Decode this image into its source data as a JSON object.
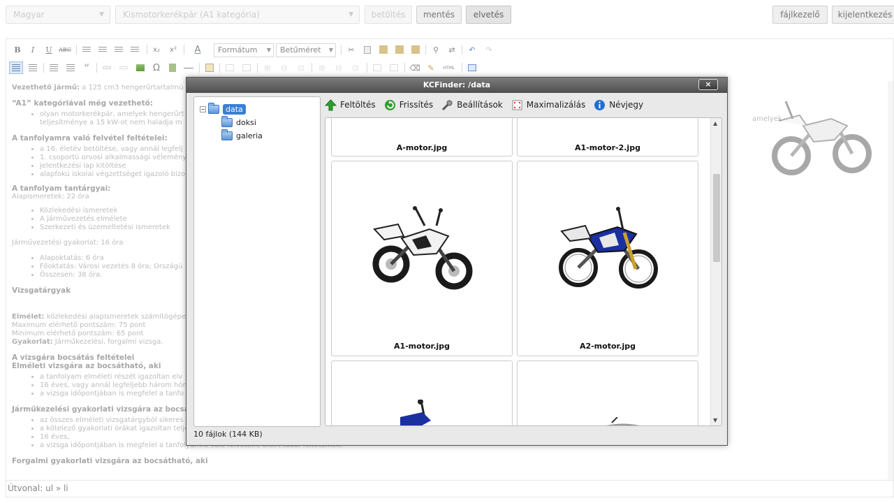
{
  "topbar": {
    "language": "Magyar",
    "category": "Kismotorkerékpár (A1 kategória)",
    "load_label": "betöltés",
    "save_label": "mentés",
    "discard_label": "elvetés",
    "filemanager_label": "fájlkezelő",
    "logout_label": "kijelentkezés"
  },
  "toolbar": {
    "bold": "B",
    "italic": "I",
    "underline": "U",
    "strike": "ABC",
    "subscript": "x₂",
    "superscript": "x²",
    "text_color": "A",
    "format_placeholder": "Formátum",
    "size_placeholder": "Betűméret",
    "omega": "Ω",
    "blockquote": "“",
    "html_label": "HTML"
  },
  "content": {
    "p1_label": "Vezethető jármű:",
    "p1_text": " a 125 cm3 hengerűrtartalmú",
    "h_a1": "“A1” kategóriával még vezethető:",
    "a1_item1": "olyan motorkerékpár, amelyek hengerűrt",
    "a1_item1_tail": "amelyek",
    "a1_item2": "teljesítménye a 15 kW-ot nem haladja m",
    "h_admission": "A tanfolyamra való felvétel feltételei:",
    "adm_items": [
      "a 16. életév betöltése, vagy annál legfelj",
      "1. csoportú orvosi alkalmassági vélemény",
      "jelentkezési lap kitöltése",
      "alapfokú iskolai végzettséget igazoló bizo"
    ],
    "h_subjects": "A tanfolyam tantárgyai:",
    "basics": "Alapismeretek: 22 óra",
    "basic_items": [
      "Közlekedési ismeretek",
      "A járművezetés elmélete",
      "Szerkezeti és üzemeltetési ismeretek"
    ],
    "driving": "Járművezetési gyakorlat: 16 óra",
    "drive_items": [
      "Alapoktatás: 6 óra",
      "Főoktatás: Városi vezetés 8 óra; Országú",
      "Összesen: 38 óra."
    ],
    "h_exams": "Vizsgatárgyak",
    "theory_label": "Elmélet:",
    "theory_text": " közlekedési alapismeretek számítógépe",
    "max_points": "Maximum elérhető pontszám: 75 pont",
    "min_points": "Minimum elérhető pontszám: 65 pont",
    "practice_label": "Gyakorlat:",
    "practice_text": " Járműkezelési, forgalmi vizsga.",
    "h_exam_cond": "A vizsgára bocsátás feltételei",
    "h_theory_exam": "Elméleti vizsgára az bocsátható, aki",
    "theory_exam_items": [
      "a tanfolyam elméleti részét igazoltan elv",
      "16 éves, vagy annál legfeljebb három hón",
      "a vizsga időpontjában is megfelel a tanfo"
    ],
    "h_handling": "Járműkezelési gyakorlati vizsgára az bocsát",
    "handling_items": [
      "az összes elméleti vizsgatárgyból sikeres",
      "a kötelező gyakorlati órákat igazoltan teljesítette",
      "16 éves,",
      "a vizsga időpontjában is megfelel a tanfolyamra való felvételre előírt többi feltételnek."
    ],
    "h_traffic": "Forgalmi gyakorlati vizsgára az bocsátható, aki"
  },
  "statusbar": {
    "path": "Útvonal: ul » li"
  },
  "kcfinder": {
    "title": "KCFinder: /data",
    "close": "×",
    "tree": {
      "root": "data",
      "children": [
        "doksi",
        "galeria"
      ],
      "expander": "−"
    },
    "toolbar": {
      "upload": "Feltöltés",
      "refresh": "Frissítés",
      "settings": "Beállítások",
      "maximize": "Maximalizálás",
      "about": "Névjegy"
    },
    "files": [
      {
        "name": "A-motor.jpg"
      },
      {
        "name": "A1-motor-2.jpg"
      },
      {
        "name": "A1-motor.jpg",
        "icon": "white-motorcycle-image"
      },
      {
        "name": "A2-motor.jpg",
        "icon": "blue-motorcycle-image"
      }
    ],
    "status": "10 fájlok (144 KB)"
  },
  "colors": {
    "selected": "#3b7fd1",
    "upload_green": "#2f9e2f",
    "about_blue": "#1f6fcf",
    "moto_blue": "#1a2fa0"
  }
}
